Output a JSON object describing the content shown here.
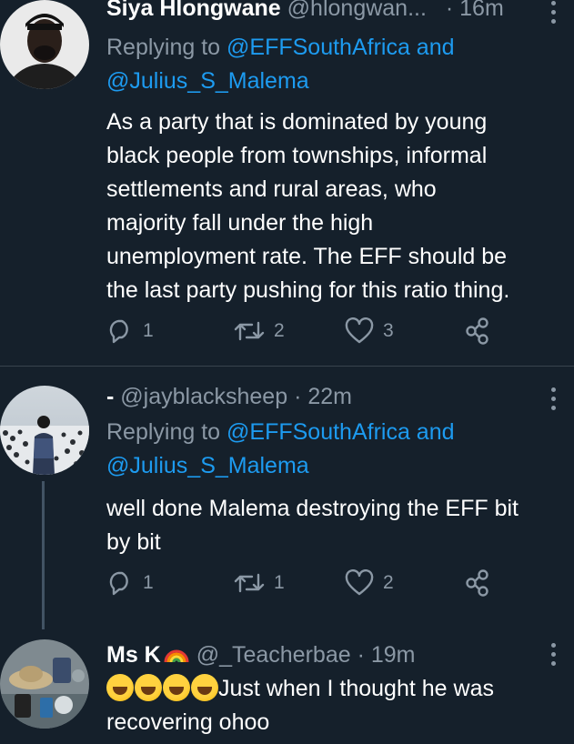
{
  "tweets": [
    {
      "name": "Siya Hlongwane",
      "handle": "@hlongwan...",
      "time": "· 16m",
      "replying_prefix": "Replying to",
      "reply_to_1": "@EFFSouthAfrica and",
      "reply_to_2": "@Julius_S_Malema",
      "text_lines": [
        "As a party that is dominated by young",
        "black people from townships, informal",
        "settlements and rural areas,  who",
        "majority fall under the high",
        "unemployment rate. The EFF should be",
        "the last party pushing for this ratio thing."
      ],
      "replies": "1",
      "retweets": "2",
      "likes": "3"
    },
    {
      "name": "-",
      "handle": "@jayblacksheep",
      "time": "· 22m",
      "replying_prefix": "Replying to",
      "reply_to_1": "@EFFSouthAfrica and",
      "reply_to_2": "@Julius_S_Malema",
      "text_lines": [
        "well done Malema destroying the EFF bit",
        "by bit"
      ],
      "replies": "1",
      "retweets": "1",
      "likes": "2"
    },
    {
      "name": "Ms K",
      "handle": "@_Teacherbae",
      "time": "· 19m",
      "text_line_1": "Just when I thought he was",
      "text_line_2": "recovering ohoo"
    }
  ],
  "icons": {
    "reply": "reply-icon",
    "retweet": "retweet-icon",
    "like": "heart-icon",
    "share": "share-icon",
    "more": "more-icon",
    "emoji": "rolling-on-floor-laughing-emoji",
    "rainbow": "rainbow-emoji"
  },
  "colors": {
    "background": "#15202b",
    "link": "#1d9bf0",
    "secondary_text": "#8b98a5",
    "divider": "#38444d"
  }
}
